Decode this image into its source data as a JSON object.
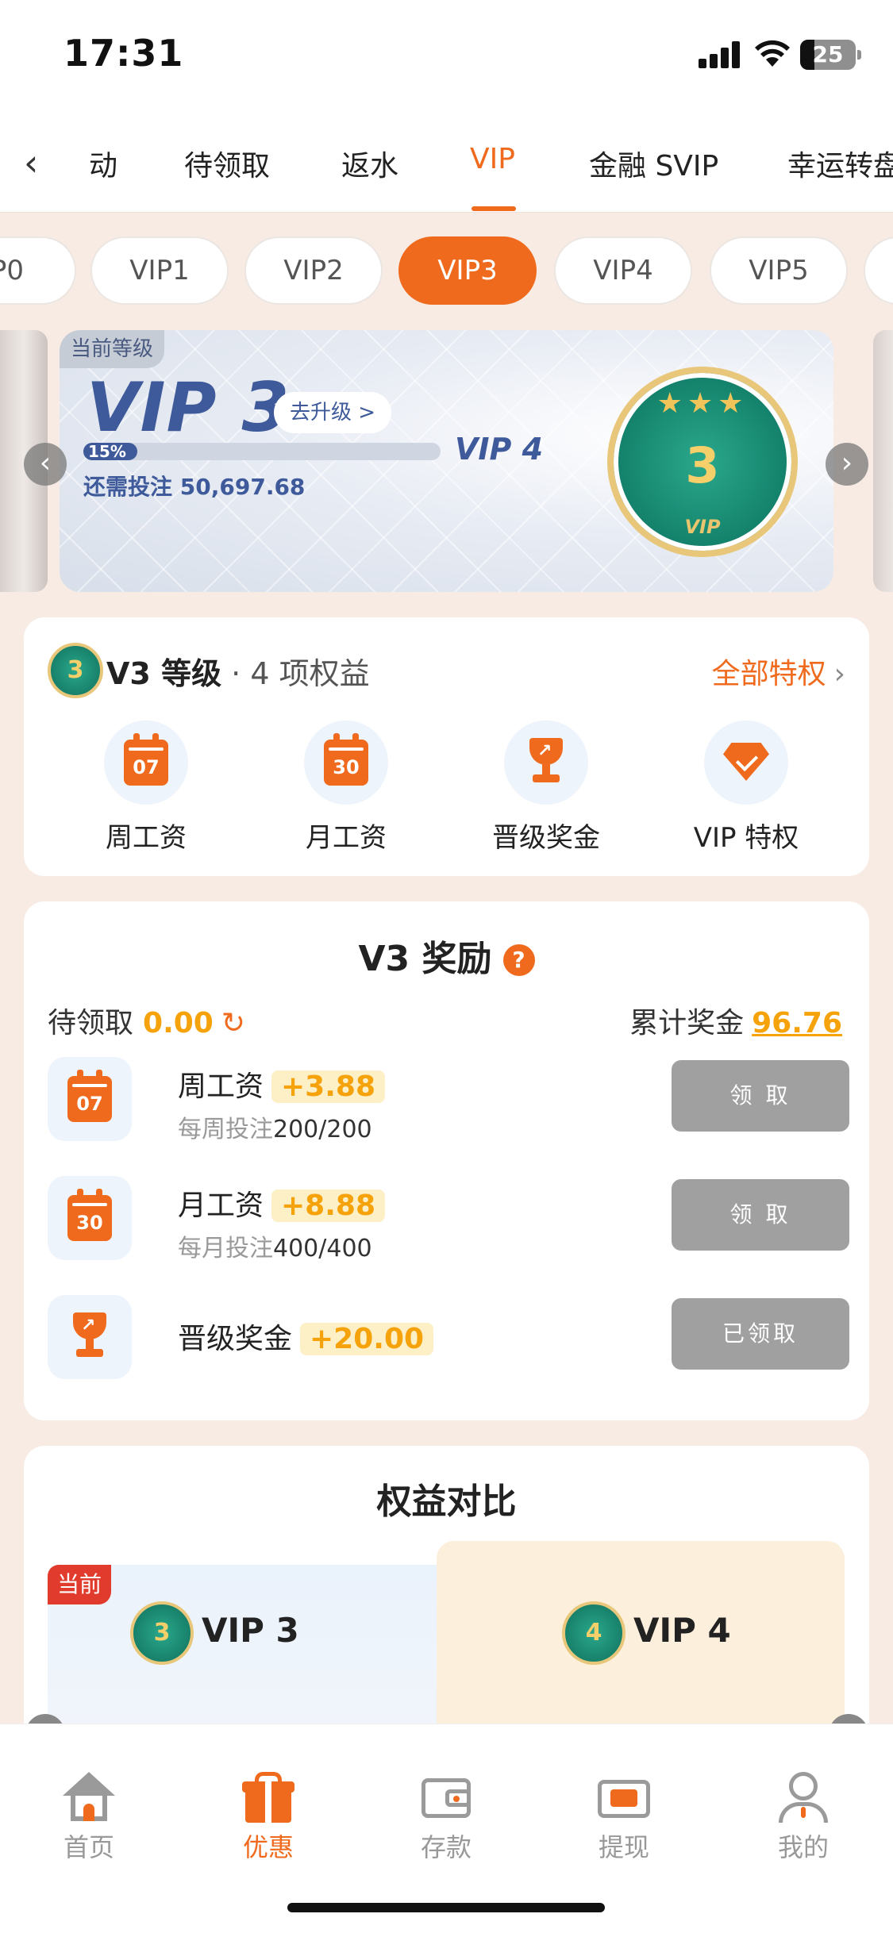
{
  "status_bar": {
    "time": "17:31",
    "battery": "25"
  },
  "top_tabs": {
    "items": [
      {
        "label": "动"
      },
      {
        "label": "待领取"
      },
      {
        "label": "返水"
      },
      {
        "label": "VIP"
      },
      {
        "label": "金融 SVIP"
      },
      {
        "label": "幸运转盘"
      }
    ],
    "active": "VIP"
  },
  "vip_pills": [
    {
      "label": "P0"
    },
    {
      "label": "VIP1"
    },
    {
      "label": "VIP2"
    },
    {
      "label": "VIP3"
    },
    {
      "label": "VIP4"
    },
    {
      "label": "VIP5"
    }
  ],
  "banner": {
    "current_tag": "当前等级",
    "level": "VIP 3",
    "upgrade_label": "去升级 >",
    "progress_percent": "15%",
    "progress_value": 0.15,
    "next_level": "VIP 4",
    "need_label": "还需投注",
    "need_amount": "50,697.68",
    "badge": {
      "number": "3",
      "stars": "★★★",
      "label": "VIP"
    }
  },
  "level_card": {
    "badge_number": "3",
    "title": "V3 等级",
    "subtitle": " · 4 项权益",
    "all_privileges": "全部特权",
    "benefits": [
      {
        "label": "周工资",
        "icon": "calendar-07-icon",
        "icon_text": "07"
      },
      {
        "label": "月工资",
        "icon": "calendar-30-icon",
        "icon_text": "30"
      },
      {
        "label": "晋级奖金",
        "icon": "trophy-icon"
      },
      {
        "label": "VIP 特权",
        "icon": "diamond-icon"
      }
    ]
  },
  "reward_card": {
    "title": "V3 奖励",
    "help": "?",
    "pending_label": "待领取",
    "pending_amount": "0.00",
    "total_label": "累计奖金",
    "total_amount": "96.76",
    "rows": [
      {
        "name": "周工资",
        "bonus": "+3.88",
        "req_label": "每周投注",
        "req_value": "200/200",
        "button": "领 取",
        "icon_text": "07"
      },
      {
        "name": "月工资",
        "bonus": "+8.88",
        "req_label": "每月投注",
        "req_value": "400/400",
        "button": "领 取",
        "icon_text": "30"
      },
      {
        "name": "晋级奖金",
        "bonus": "+20.00",
        "button": "已领取"
      }
    ]
  },
  "compare_card": {
    "title": "权益对比",
    "current_flag": "当前",
    "left_level": "VIP 3",
    "left_badge": "3",
    "right_level": "VIP 4",
    "right_badge": "4"
  },
  "tab_bar": {
    "items": [
      {
        "label": "首页",
        "icon": "home-icon"
      },
      {
        "label": "优惠",
        "icon": "gift-icon"
      },
      {
        "label": "存款",
        "icon": "wallet-icon"
      },
      {
        "label": "提现",
        "icon": "cash-icon"
      },
      {
        "label": "我的",
        "icon": "profile-icon"
      }
    ],
    "active": "优惠"
  },
  "colors": {
    "accent": "#f06a1d",
    "gold": "#f5a20b",
    "vip_blue": "#3e5a9a",
    "disabled_button": "#a0a0a0"
  }
}
